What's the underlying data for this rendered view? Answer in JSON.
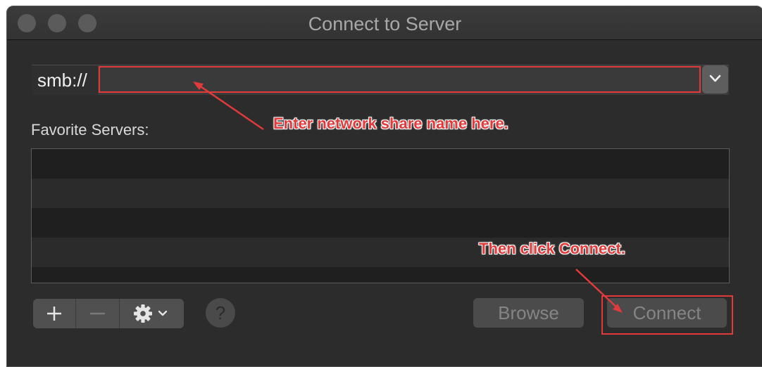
{
  "window": {
    "title": "Connect to Server"
  },
  "server_address": {
    "scheme": "smb://",
    "value": "",
    "placeholder": ""
  },
  "favorites": {
    "label": "Favorite Servers:",
    "items": []
  },
  "bottom_bar": {
    "add_icon": "plus-icon",
    "remove_icon": "minus-icon",
    "settings_icon": "gear-icon",
    "help_label": "?"
  },
  "buttons": {
    "browse_label": "Browse",
    "connect_label": "Connect"
  },
  "annotations": {
    "input_hint": "Enter network share name here.",
    "connect_hint": "Then click Connect.",
    "highlight_color": "#e23a3a"
  }
}
